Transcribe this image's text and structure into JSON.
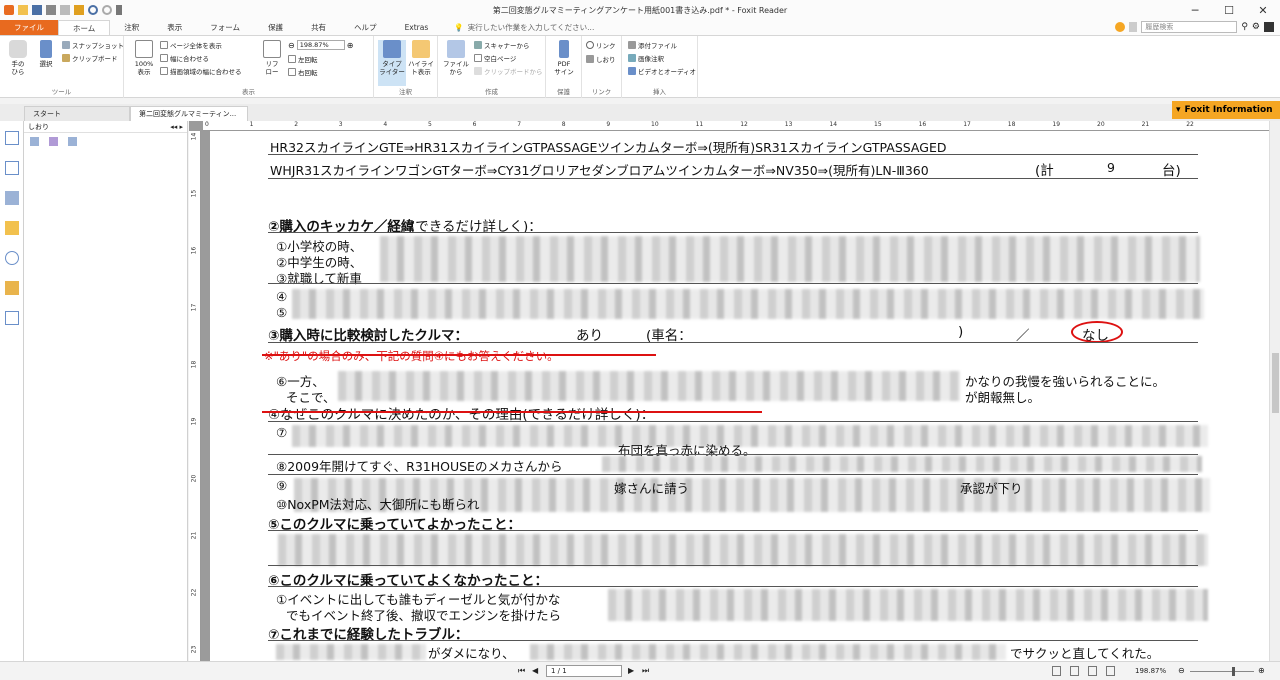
{
  "window": {
    "title": "第二回変態グルマミーティングアンケート用紙001書き込み.pdf * - Foxit Reader",
    "min_label": "─",
    "max_label": "☐",
    "close_label": "✕"
  },
  "menu_tabs": [
    "ファイル",
    "ホーム",
    "注釈",
    "表示",
    "フォーム",
    "保護",
    "共有",
    "ヘルプ",
    "Extras"
  ],
  "tell_me": "実行したい作業を入力してください...",
  "search_placeholder": "履歴検索",
  "ribbon": {
    "hand": "手の\nひら",
    "select": "選択",
    "snapshot": "スナップショット",
    "clipboard": "クリップボード",
    "tools_label": "ツール",
    "fit_page": "ページ全体を表示",
    "fit_width": "幅に合わせる",
    "fit_visible": "描画領域の幅に合わせる",
    "actual": "100%\n表示",
    "reflow": "リフ\nロー",
    "zoom_value": "198.87%",
    "rotate_left": "左回転",
    "rotate_right": "右回転",
    "view_label": "表示",
    "typewriter": "タイプ\nライター",
    "highlight": "ハイライ\nト表示",
    "comment_label": "注釈",
    "from_file": "ファイル\nから",
    "from_scanner": "スキャナーから",
    "blank_page": "空白ページ",
    "from_clipboard": "クリップボードから",
    "create_label": "作成",
    "pdf_sign": "PDF\nサイン",
    "protect_label": "保護",
    "link": "リンク",
    "bookmark": "しおり",
    "link_label": "リンク",
    "attach": "添付ファイル",
    "image_note": "画像注釈",
    "video_audio": "ビデオとオーディオ",
    "insert_label": "挿入"
  },
  "doc_tabs": [
    "スタート",
    "第二回変態グルマミーティン..."
  ],
  "foxit_info": "Foxit Information",
  "side_panel": {
    "title": "しおり"
  },
  "document": {
    "line1": "HR32スカイラインGTE⇒HR31スカイラインGTPASSAGEツインカムターボ⇒(現所有)SR31スカイラインGTPASSAGED",
    "line2": "WHJR31スカイラインワゴンGTターボ⇒CY31グロリアセダンブロアムツインカムターボ⇒NV350⇒(現所有)LN-Ⅲ360",
    "line2_total": "(計",
    "line2_count": "9",
    "line2_unit": "台)",
    "q2": "②購入のキッカケ／経緯",
    "q2_note": "(できるだけ詳しく)：",
    "a2_1": "①小学校の時、",
    "a2_2": "②中学生の時、",
    "a2_3": "③就職して新車",
    "a2_4": "④",
    "a2_5": "⑤",
    "q3": "③購入時に比較検討したクルマ：",
    "q3_yes": "あり",
    "q3_car": "(車名：",
    "q3_close": ")",
    "q3_slash": "／",
    "q3_no": "なし",
    "q3_note": "※\"あり\"の場合のみ、下記の質問④にもお答えください。",
    "a6_a": "⑥一方、",
    "a6_b": "かなりの我慢を強いられることに。",
    "a6_c": "そこで、",
    "a6_d": "が朗報無し。",
    "q4": "④なぜこのクルマに決めたのか、その理由(できるだけ詳しく)：",
    "a7": "⑦",
    "a7_b": "布団を真っ赤に染める。",
    "a8": "⑧2009年開けてすぐ、R31HOUSEのメカさんから",
    "a9": "⑨",
    "a9_b": "嫁さんに請う",
    "a9_c": "承認が下り",
    "a10": "⑩NoxPM法対応、大御所にも断られ",
    "q5": "⑤このクルマに乗っていてよかったこと：",
    "q6": "⑥このクルマに乗っていてよくなかったこと：",
    "a6q_1": "①イベントに出しても誰もディーゼルと気が付かな",
    "a6q_2": "でもイベント終了後、撤収でエンジンを掛けたら",
    "q7": "⑦これまでに経験したトラブル：",
    "a7q_a": "がダメになり、",
    "a7q_b": "でサクッと直してくれた。"
  },
  "ruler_h": [
    "0",
    "1",
    "2",
    "3",
    "4",
    "5",
    "6",
    "7",
    "8",
    "9",
    "10",
    "11",
    "12",
    "13",
    "14",
    "15",
    "16",
    "17",
    "18",
    "19",
    "20",
    "21",
    "22"
  ],
  "ruler_v": [
    "14",
    "15",
    "16",
    "17",
    "18",
    "19",
    "20",
    "21",
    "22",
    "23"
  ],
  "status": {
    "page": "1 / 1",
    "zoom": "198.87%"
  },
  "colors": {
    "accent": "#e86a1f",
    "foxit": "#f5a623",
    "annotation_red": "#d11111"
  }
}
